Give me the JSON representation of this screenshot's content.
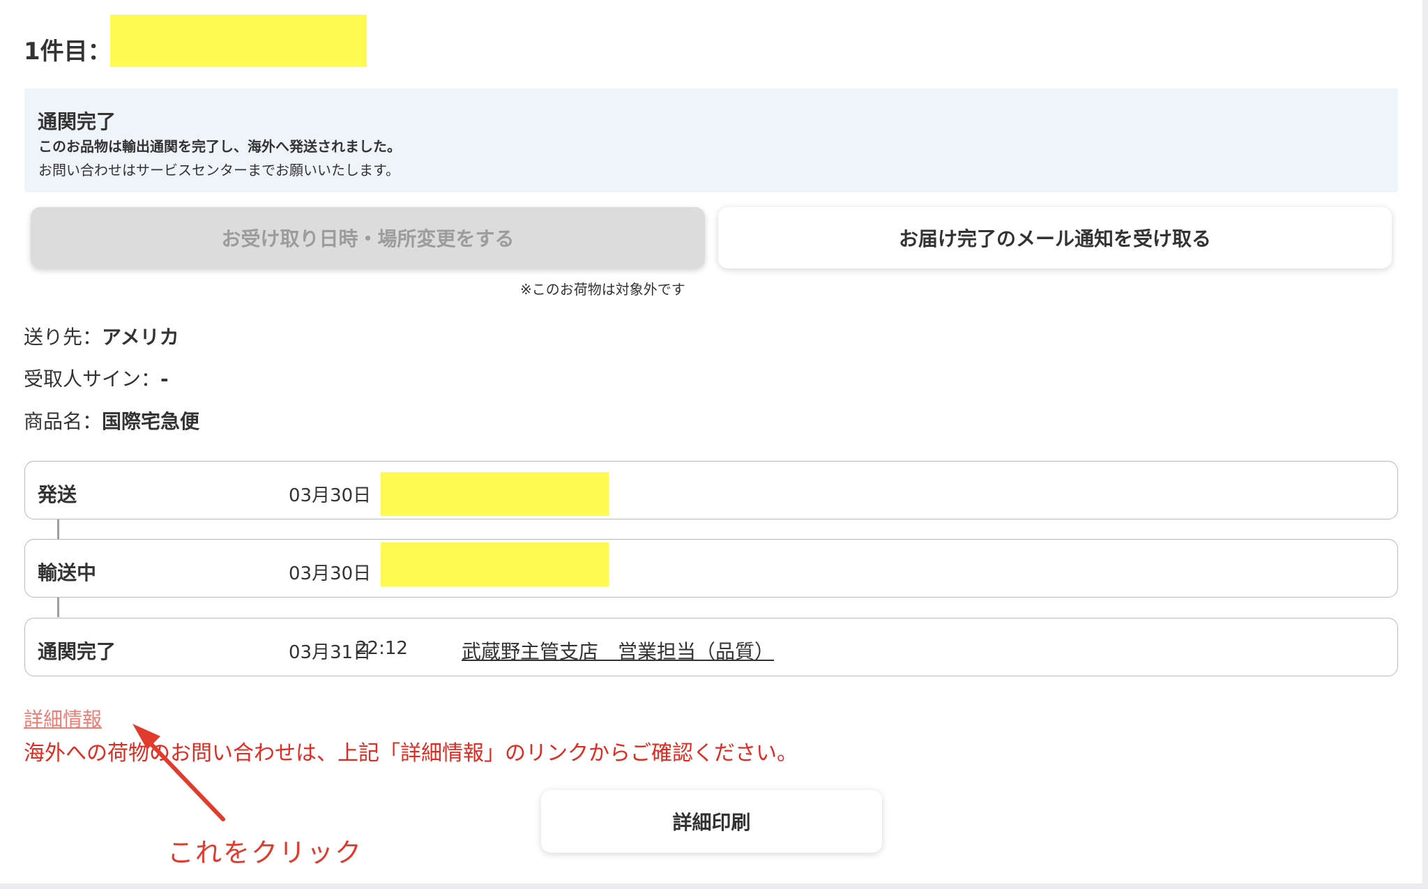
{
  "heading": "1件目：",
  "notice": {
    "title": "通関完了",
    "line1": "このお品物は輸出通関を完了し、海外へ発送されました。",
    "line2": "お問い合わせはサービスセンターまでお願いいたします。"
  },
  "buttons": {
    "change_delivery": "お受け取り日時・場所変更をする",
    "mail_notify": "お届け完了のメール通知を受け取る",
    "not_applicable_note": "※このお荷物は対象外です",
    "print": "詳細印刷"
  },
  "info": {
    "destination_label": "送り先：",
    "destination_value": "アメリカ",
    "signature_label": "受取人サイン：",
    "signature_value": "-",
    "product_label": "商品名：",
    "product_value": "国際宅急便"
  },
  "tracking": [
    {
      "status": "発送",
      "date": "03月30日",
      "time": "",
      "place": ""
    },
    {
      "status": "輸送中",
      "date": "03月30日",
      "time": "",
      "place": ""
    },
    {
      "status": "通関完了",
      "date": "03月31日",
      "time": "22:12",
      "place": "武蔵野主管支店　営業担当（品質）"
    }
  ],
  "detail_link": "詳細情報",
  "overseas_note": "海外への荷物のお問い合わせは、上記「詳細情報」のリンクからご確認ください。",
  "annotation": "これをクリック",
  "colors": {
    "redaction": "#fefa52",
    "notice_bg": "#eff3fa",
    "link": "#ef7d74",
    "note_red": "#e12a20",
    "annotation_red": "#e23b2e"
  }
}
